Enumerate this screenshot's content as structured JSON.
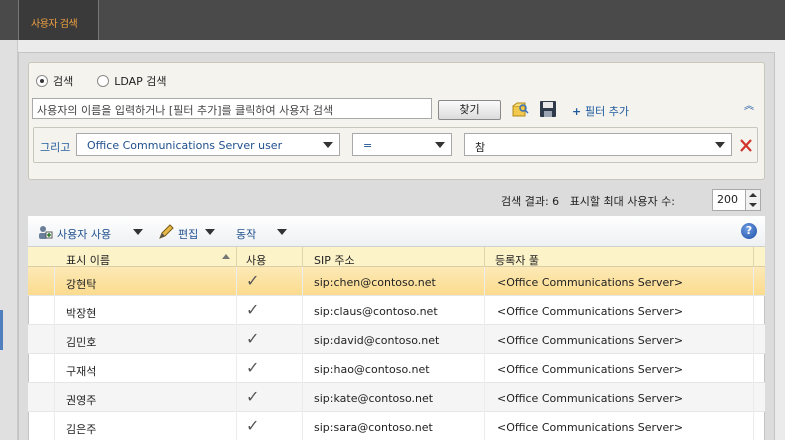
{
  "top_tab": {
    "label": "사용자 검색"
  },
  "search": {
    "radio_search": "검색",
    "radio_ldap": "LDAP 검색",
    "input_value": "사용자의 이름을 입력하거나 [필터 추가]를 클릭하여 사용자 검색",
    "find_button": "찾기",
    "add_filter": "필터 추가"
  },
  "filter": {
    "and_label": "그리고",
    "field": "Office Communications Server user",
    "operator": "=",
    "value": "참"
  },
  "results": {
    "summary": "검색 결과: 6",
    "max_label": "표시할 최대 사용자 수:",
    "max_value": "200"
  },
  "toolbar": {
    "enable_user": "사용자 사용",
    "edit": "편집",
    "action": "동작",
    "help": "?"
  },
  "table": {
    "headers": [
      "표시 이름",
      "사용",
      "SIP 주소",
      "등록자 풀"
    ],
    "rows": [
      {
        "name": "강현탁",
        "enabled": "✓",
        "sip": "sip:chen@contoso.net",
        "pool": "<Office Communications Server>"
      },
      {
        "name": "박장현",
        "enabled": "✓",
        "sip": "sip:claus@contoso.net",
        "pool": "<Office Communications Server>"
      },
      {
        "name": "김민호",
        "enabled": "✓",
        "sip": "sip:david@contoso.net",
        "pool": "<Office Communications Server>"
      },
      {
        "name": "구재석",
        "enabled": "✓",
        "sip": "sip:hao@contoso.net",
        "pool": "<Office Communications Server>"
      },
      {
        "name": "권영주",
        "enabled": "✓",
        "sip": "sip:kate@contoso.net",
        "pool": "<Office Communications Server>"
      },
      {
        "name": "김은주",
        "enabled": "✓",
        "sip": "sip:sara@contoso.net",
        "pool": "<Office Communications Server>"
      }
    ]
  },
  "colors": {
    "accent": "#1f5a9e",
    "selected_row": "#fbdc8e",
    "header_bg": "#fdf3c8"
  }
}
